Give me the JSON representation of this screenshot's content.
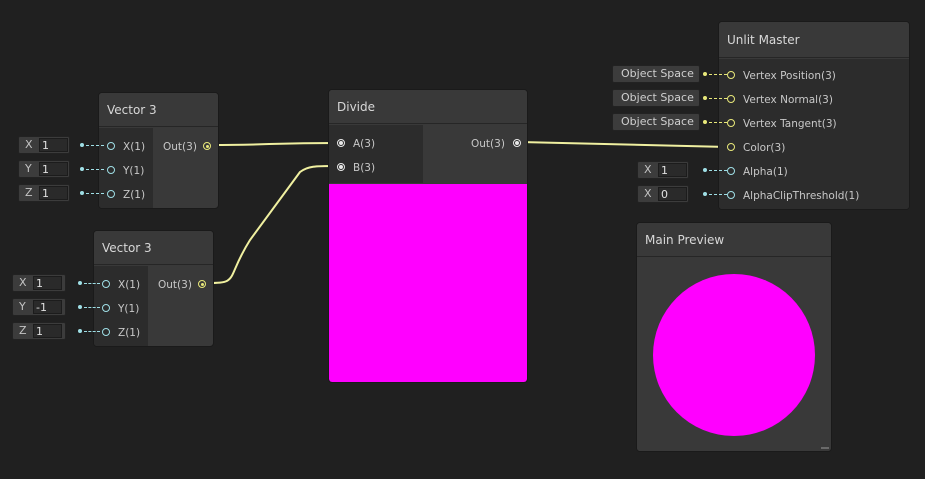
{
  "nodes": {
    "vector3_a": {
      "title": "Vector 3",
      "inputs": [
        "X(1)",
        "Y(1)",
        "Z(1)"
      ],
      "output": "Out(3)",
      "fields": [
        {
          "axis": "X",
          "value": "1"
        },
        {
          "axis": "Y",
          "value": "1"
        },
        {
          "axis": "Z",
          "value": "1"
        }
      ]
    },
    "vector3_b": {
      "title": "Vector 3",
      "inputs": [
        "X(1)",
        "Y(1)",
        "Z(1)"
      ],
      "output": "Out(3)",
      "fields": [
        {
          "axis": "X",
          "value": "1"
        },
        {
          "axis": "Y",
          "value": "-1"
        },
        {
          "axis": "Z",
          "value": "1"
        }
      ]
    },
    "divide": {
      "title": "Divide",
      "inputs": [
        "A(3)",
        "B(3)"
      ],
      "output": "Out(3)",
      "preview_color": "#ff00ff"
    },
    "unlit_master": {
      "title": "Unlit Master",
      "inputs": [
        "Vertex Position(3)",
        "Vertex Normal(3)",
        "Vertex Tangent(3)",
        "Color(3)",
        "Alpha(1)",
        "AlphaClipThreshold(1)"
      ],
      "space_fields": [
        "Object Space",
        "Object Space",
        "Object Space"
      ],
      "fields": [
        {
          "axis": "X",
          "value": "1"
        },
        {
          "axis": "X",
          "value": "0"
        }
      ]
    },
    "main_preview": {
      "title": "Main Preview",
      "preview_color": "#ff00ff"
    }
  },
  "colors": {
    "background": "#202020",
    "wire": "#f0f0a0",
    "vector_port": "#9fdfe6",
    "preview": "#ff00ff"
  }
}
